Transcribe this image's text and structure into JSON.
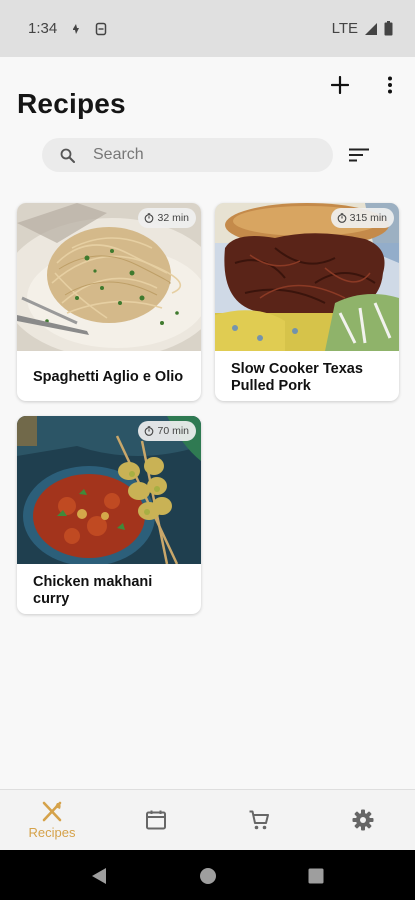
{
  "status_bar": {
    "time": "1:34",
    "network": "LTE"
  },
  "app_bar": {
    "title": "Recipes",
    "add_icon": "plus-icon",
    "more_icon": "more-vert-icon"
  },
  "search": {
    "placeholder": "Search",
    "value": "",
    "sort_icon": "sort-icon"
  },
  "recipes": [
    {
      "name": "Spaghetti Aglio e Olio",
      "time": "32 min"
    },
    {
      "name": "Slow Cooker Texas Pulled Pork",
      "time": "315 min"
    },
    {
      "name": "Chicken makhani curry",
      "time": "70 min"
    }
  ],
  "bottom_nav": {
    "active_color": "#d5a24a",
    "items": [
      {
        "label": "Recipes",
        "icon": "fork-knife-icon",
        "active": true
      },
      {
        "label": "",
        "icon": "calendar-icon",
        "active": false
      },
      {
        "label": "",
        "icon": "cart-icon",
        "active": false
      },
      {
        "label": "",
        "icon": "gear-icon",
        "active": false
      }
    ]
  }
}
